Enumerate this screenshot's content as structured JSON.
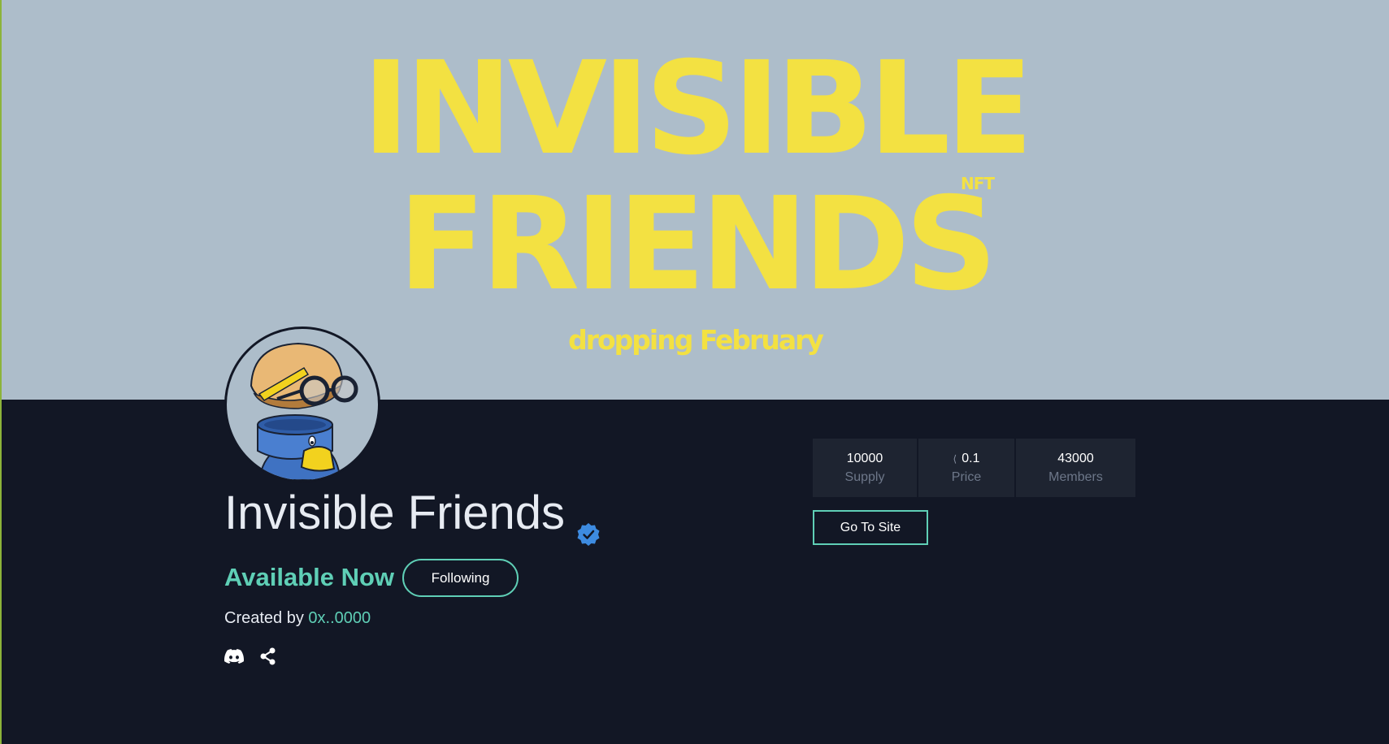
{
  "banner": {
    "line1": "INVISIBLE",
    "line2": "FRIENDS",
    "nft": "NFT",
    "subtitle": "dropping February"
  },
  "collection": {
    "name": "Invisible Friends",
    "status": "Available Now",
    "follow_label": "Following",
    "created_by_label": "Created by",
    "creator": "0x..0000"
  },
  "stats": [
    {
      "value": "10000",
      "label": "Supply"
    },
    {
      "value": "0.1",
      "label": "Price",
      "icon": "eth-icon"
    },
    {
      "value": "43000",
      "label": "Members"
    }
  ],
  "site_button_label": "Go To Site",
  "social": [
    "discord-icon",
    "share-icon"
  ],
  "colors": {
    "banner_bg": "#adbdca",
    "banner_text": "#f3e142",
    "page_bg": "#121725",
    "accent": "#5fcfb6",
    "verified": "#3d8be0"
  }
}
